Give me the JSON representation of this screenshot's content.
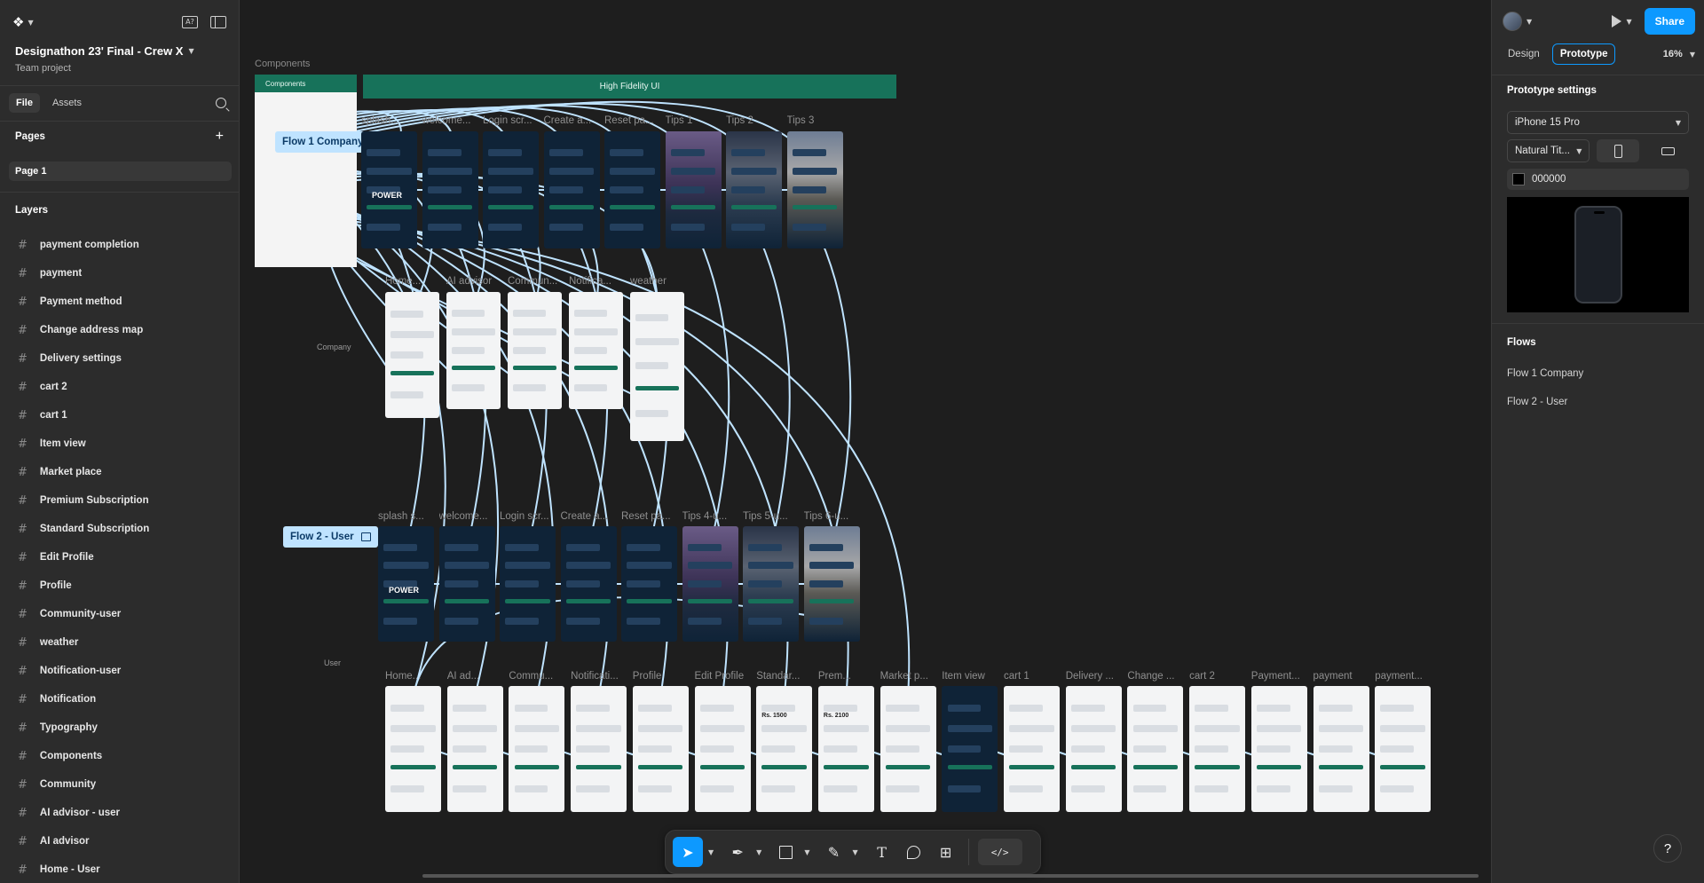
{
  "app": {
    "project_title": "Designathon 23' Final - Crew X",
    "project_subtitle": "Team project"
  },
  "left_panel": {
    "tabs": [
      "File",
      "Assets"
    ],
    "pages_label": "Pages",
    "current_page": "Page 1",
    "layers_label": "Layers",
    "layers": [
      "payment completion",
      "payment",
      "Payment method",
      "Change address map",
      "Delivery settings",
      "cart 2",
      "cart 1",
      "Item view",
      "Market place",
      "Premium Subscription",
      "Standard Subscription",
      "Edit Profile",
      "Profile",
      "Community-user",
      "weather",
      "Notification-user",
      "Notification",
      "Typography",
      "Components",
      "Community",
      "AI advisor - user",
      "AI advisor",
      "Home - User"
    ],
    "icons": {
      "logo": "figma-logo-icon",
      "ai": "ai-icon",
      "layout": "panel-toggle-icon",
      "search": "search-icon",
      "add": "plus-icon"
    }
  },
  "right_panel": {
    "share_label": "Share",
    "modes": [
      "Design",
      "Prototype"
    ],
    "active_mode": "Prototype",
    "zoom": "16%",
    "prototype_settings_label": "Prototype settings",
    "device": "iPhone 15 Pro",
    "model": "Natural Tit...",
    "background_color_hex": "000000",
    "flows_label": "Flows",
    "flows": [
      "Flow 1 Company",
      "Flow 2 - User"
    ],
    "help_label": "?"
  },
  "canvas": {
    "components_label": "Components",
    "components_header": "Components",
    "hifi_header": "High Fidelity UI",
    "flow1_tag": "Flow 1 Company",
    "flow2_tag": "Flow 2 - User",
    "company_label": "Company",
    "user_label": "User",
    "row1_titles": [
      "splash...",
      "welcome...",
      "Login scr...",
      "Create a...",
      "Reset pa...",
      "Tips 1",
      "Tips 2",
      "Tips 3"
    ],
    "row2_titles": [
      "Home...",
      "AI advisor",
      "Commun...",
      "Notifica...",
      "weather"
    ],
    "row3_titles": [
      "splash s...",
      "welcome...",
      "Login scr...",
      "Create a...",
      "Reset pa...",
      "Tips 4-u...",
      "Tips 5-u...",
      "Tips 6-u..."
    ],
    "row4_titles": [
      "Home...",
      "AI ad...",
      "Commu...",
      "Notificati...",
      "Profile",
      "Edit Profile",
      "Standar...",
      "Prem...",
      "Market p...",
      "Item view",
      "cart 1",
      "Delivery ...",
      "Change ...",
      "cart 2",
      "Payment...",
      "payment",
      "payment..."
    ],
    "brand_text": "POWER",
    "price_standard": "Rs. 1500",
    "price_premium": "Rs. 2100"
  },
  "toolbar": {
    "tools": [
      "move-tool-icon",
      "pen-tool-icon",
      "frame-tool-icon",
      "pencil-tool-icon",
      "text-tool-icon",
      "comment-tool-icon",
      "components-icon"
    ],
    "text_tool_glyph": "T",
    "dev_mode_label": "</>"
  },
  "colors": {
    "accent": "#0d99ff",
    "header_green": "#17725a",
    "wire": "#bfe3ff",
    "screen_dark": "#0f2337"
  }
}
